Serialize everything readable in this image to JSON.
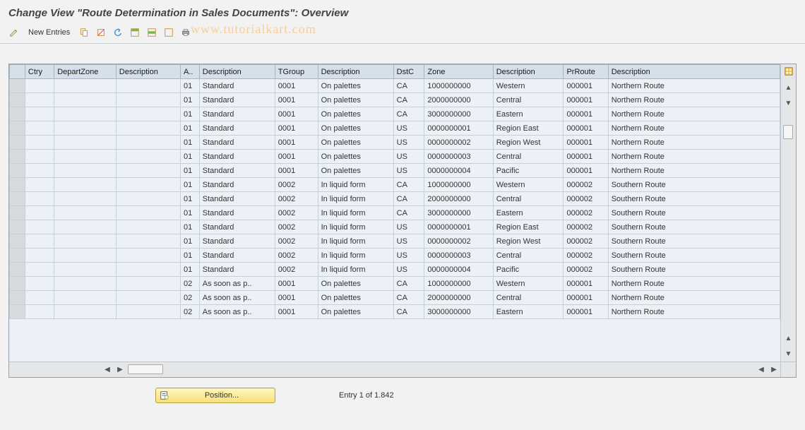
{
  "title": "Change View \"Route Determination in Sales Documents\": Overview",
  "toolbar": {
    "new_entries": "New Entries"
  },
  "watermark": "www.tutorialkart.com",
  "columns": [
    "Ctry",
    "DepartZone",
    "Description",
    "A..",
    "Description",
    "TGroup",
    "Description",
    "DstC",
    "Zone",
    "Description",
    "PrRoute",
    "Description"
  ],
  "rows": [
    {
      "ctry": "",
      "dz": "",
      "d1": "",
      "a": "01",
      "d2": "Standard",
      "tg": "0001",
      "d3": "On palettes",
      "dstc": "CA",
      "zone": "1000000000",
      "d4": "Western",
      "pr": "000001",
      "d5": "Northern Route"
    },
    {
      "ctry": "",
      "dz": "",
      "d1": "",
      "a": "01",
      "d2": "Standard",
      "tg": "0001",
      "d3": "On palettes",
      "dstc": "CA",
      "zone": "2000000000",
      "d4": "Central",
      "pr": "000001",
      "d5": "Northern Route"
    },
    {
      "ctry": "",
      "dz": "",
      "d1": "",
      "a": "01",
      "d2": "Standard",
      "tg": "0001",
      "d3": "On palettes",
      "dstc": "CA",
      "zone": "3000000000",
      "d4": "Eastern",
      "pr": "000001",
      "d5": "Northern Route"
    },
    {
      "ctry": "",
      "dz": "",
      "d1": "",
      "a": "01",
      "d2": "Standard",
      "tg": "0001",
      "d3": "On palettes",
      "dstc": "US",
      "zone": "0000000001",
      "d4": "Region East",
      "pr": "000001",
      "d5": "Northern Route"
    },
    {
      "ctry": "",
      "dz": "",
      "d1": "",
      "a": "01",
      "d2": "Standard",
      "tg": "0001",
      "d3": "On palettes",
      "dstc": "US",
      "zone": "0000000002",
      "d4": "Region West",
      "pr": "000001",
      "d5": "Northern Route"
    },
    {
      "ctry": "",
      "dz": "",
      "d1": "",
      "a": "01",
      "d2": "Standard",
      "tg": "0001",
      "d3": "On palettes",
      "dstc": "US",
      "zone": "0000000003",
      "d4": "Central",
      "pr": "000001",
      "d5": "Northern Route"
    },
    {
      "ctry": "",
      "dz": "",
      "d1": "",
      "a": "01",
      "d2": "Standard",
      "tg": "0001",
      "d3": "On palettes",
      "dstc": "US",
      "zone": "0000000004",
      "d4": "Pacific",
      "pr": "000001",
      "d5": "Northern Route"
    },
    {
      "ctry": "",
      "dz": "",
      "d1": "",
      "a": "01",
      "d2": "Standard",
      "tg": "0002",
      "d3": "In liquid form",
      "dstc": "CA",
      "zone": "1000000000",
      "d4": "Western",
      "pr": "000002",
      "d5": "Southern Route"
    },
    {
      "ctry": "",
      "dz": "",
      "d1": "",
      "a": "01",
      "d2": "Standard",
      "tg": "0002",
      "d3": "In liquid form",
      "dstc": "CA",
      "zone": "2000000000",
      "d4": "Central",
      "pr": "000002",
      "d5": "Southern Route"
    },
    {
      "ctry": "",
      "dz": "",
      "d1": "",
      "a": "01",
      "d2": "Standard",
      "tg": "0002",
      "d3": "In liquid form",
      "dstc": "CA",
      "zone": "3000000000",
      "d4": "Eastern",
      "pr": "000002",
      "d5": "Southern Route"
    },
    {
      "ctry": "",
      "dz": "",
      "d1": "",
      "a": "01",
      "d2": "Standard",
      "tg": "0002",
      "d3": "In liquid form",
      "dstc": "US",
      "zone": "0000000001",
      "d4": "Region East",
      "pr": "000002",
      "d5": "Southern Route"
    },
    {
      "ctry": "",
      "dz": "",
      "d1": "",
      "a": "01",
      "d2": "Standard",
      "tg": "0002",
      "d3": "In liquid form",
      "dstc": "US",
      "zone": "0000000002",
      "d4": "Region West",
      "pr": "000002",
      "d5": "Southern Route"
    },
    {
      "ctry": "",
      "dz": "",
      "d1": "",
      "a": "01",
      "d2": "Standard",
      "tg": "0002",
      "d3": "In liquid form",
      "dstc": "US",
      "zone": "0000000003",
      "d4": "Central",
      "pr": "000002",
      "d5": "Southern Route"
    },
    {
      "ctry": "",
      "dz": "",
      "d1": "",
      "a": "01",
      "d2": "Standard",
      "tg": "0002",
      "d3": "In liquid form",
      "dstc": "US",
      "zone": "0000000004",
      "d4": "Pacific",
      "pr": "000002",
      "d5": "Southern Route"
    },
    {
      "ctry": "",
      "dz": "",
      "d1": "",
      "a": "02",
      "d2": "As soon as p..",
      "tg": "0001",
      "d3": "On palettes",
      "dstc": "CA",
      "zone": "1000000000",
      "d4": "Western",
      "pr": "000001",
      "d5": "Northern Route"
    },
    {
      "ctry": "",
      "dz": "",
      "d1": "",
      "a": "02",
      "d2": "As soon as p..",
      "tg": "0001",
      "d3": "On palettes",
      "dstc": "CA",
      "zone": "2000000000",
      "d4": "Central",
      "pr": "000001",
      "d5": "Northern Route"
    },
    {
      "ctry": "",
      "dz": "",
      "d1": "",
      "a": "02",
      "d2": "As soon as p..",
      "tg": "0001",
      "d3": "On palettes",
      "dstc": "CA",
      "zone": "3000000000",
      "d4": "Eastern",
      "pr": "000001",
      "d5": "Northern Route"
    }
  ],
  "footer": {
    "position_label": "Position...",
    "entry_text": "Entry 1 of 1.842"
  }
}
